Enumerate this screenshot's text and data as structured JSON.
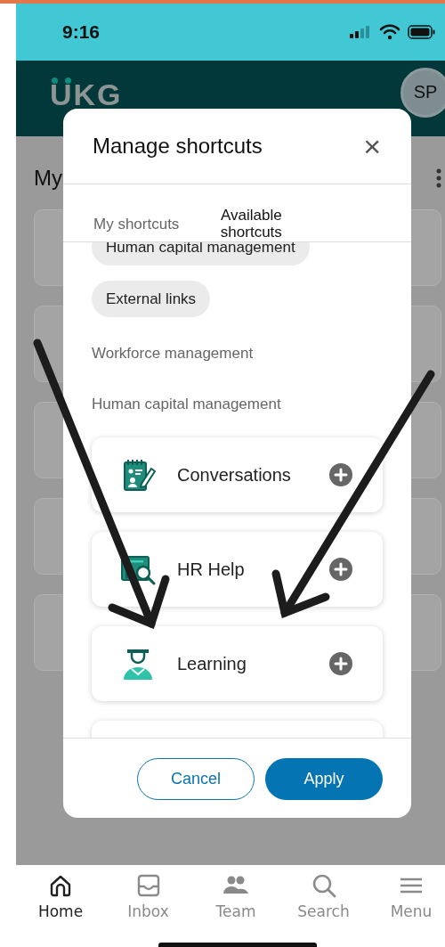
{
  "status_bar": {
    "time": "9:16"
  },
  "header": {
    "logo": "UKG",
    "avatar": "SP"
  },
  "page": {
    "title": "My"
  },
  "modal": {
    "title": "Manage shortcuts",
    "close": "×",
    "tabs": [
      {
        "label": "My shortcuts",
        "selected": false
      },
      {
        "label": "Available shortcuts",
        "selected": true
      }
    ],
    "chips": [
      "Human capital management",
      "External links"
    ],
    "sections": [
      {
        "heading": "Workforce management"
      },
      {
        "heading": "Human capital management",
        "items": [
          {
            "kind": "shortcut",
            "label": "Conversations"
          },
          {
            "kind": "shortcut",
            "label": "HR Help"
          },
          {
            "kind": "shortcut",
            "label": "Learning"
          },
          {
            "kind": "cut-off"
          }
        ]
      }
    ],
    "buttons": [
      {
        "label": "Cancel",
        "kind": "secondary"
      },
      {
        "label": "Apply",
        "kind": "primary"
      }
    ]
  },
  "annotations": [
    {
      "kind": "arrow"
    },
    {
      "kind": "arrow"
    }
  ],
  "tab_bar": [
    {
      "label": "Home",
      "selected": true
    },
    {
      "label": "Inbox",
      "selected": false
    },
    {
      "label": "Team",
      "selected": false
    },
    {
      "label": "Search",
      "selected": false
    },
    {
      "label": "Menu",
      "selected": false
    }
  ]
}
